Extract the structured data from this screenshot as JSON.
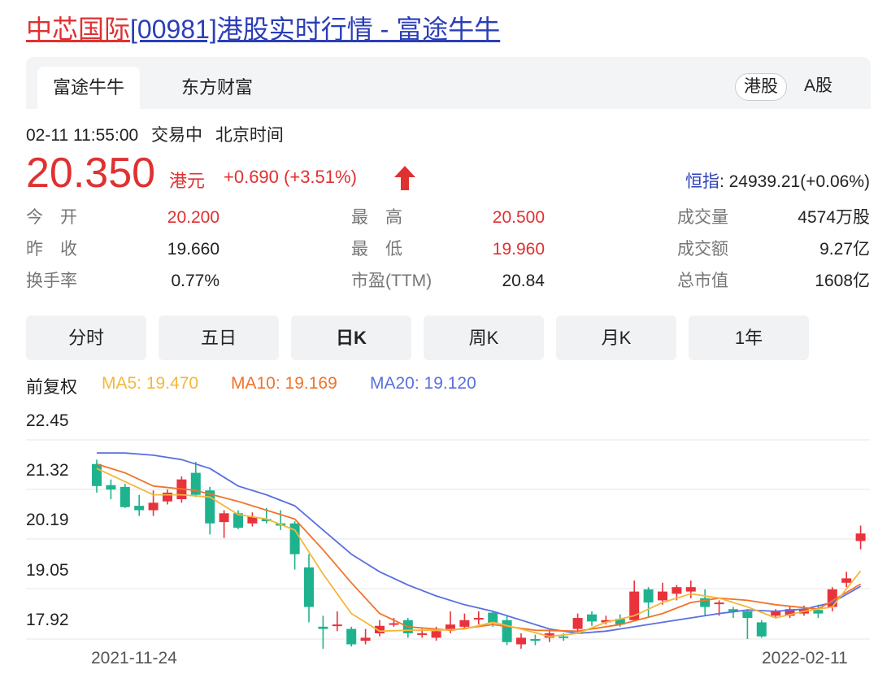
{
  "page": {
    "title_name": "中芯国际",
    "title_rest": "[00981]港股实时行情 - 富途牛牛"
  },
  "tabs": [
    "富途牛牛",
    "东方财富"
  ],
  "market": {
    "hk": "港股",
    "a": "A股"
  },
  "quote": {
    "datetime": "02-11 11:55:00",
    "status": "交易中",
    "tz": "北京时间",
    "price": "20.350",
    "currency": "港元",
    "change": "+0.690 (+3.51%)",
    "hsi_label": "恒指",
    "hsi_value": ": 24939.21(+0.06%)"
  },
  "stats": [
    [
      {
        "k": "今　开",
        "v": "20.200",
        "red": true
      },
      {
        "k": "最　高",
        "v": "20.500",
        "red": true
      },
      {
        "k": "成交量",
        "v": "4574万股",
        "red": false
      }
    ],
    [
      {
        "k": "昨　收",
        "v": "19.660",
        "red": false
      },
      {
        "k": "最　低",
        "v": "19.960",
        "red": true
      },
      {
        "k": "成交额",
        "v": "9.27亿",
        "red": false
      }
    ],
    [
      {
        "k": "换手率",
        "v": "0.77%",
        "red": false
      },
      {
        "k": "市盈(TTM)",
        "v": "20.84",
        "red": false
      },
      {
        "k": "总市值",
        "v": "1608亿",
        "red": false
      }
    ]
  ],
  "periods": [
    "分时",
    "五日",
    "日K",
    "周K",
    "月K",
    "1年"
  ],
  "active_period": "日K",
  "ma": {
    "adj": "前复权",
    "ma5": "MA5: 19.470",
    "ma10": "MA10: 19.169",
    "ma20": "MA20: 19.120"
  },
  "colors": {
    "up": "#e8323c",
    "down": "#1fb28e",
    "ma5": "#f4b73a",
    "ma10": "#f0742a",
    "ma20": "#5b6fe0",
    "accent_red": "#e03131",
    "link_blue": "#2b3eb8"
  },
  "chart_data": {
    "type": "candlestick",
    "y_ticks": [
      "22.45",
      "21.32",
      "20.19",
      "19.05",
      "17.92"
    ],
    "ylim": [
      17.5,
      22.6
    ],
    "x_start_label": "2021-11-24",
    "x_end_label": "2022-02-11",
    "candles": [
      {
        "o": 21.9,
        "c": 21.4,
        "h": 22.0,
        "l": 21.25
      },
      {
        "o": 21.42,
        "c": 21.32,
        "h": 21.55,
        "l": 21.1
      },
      {
        "o": 21.38,
        "c": 20.92,
        "h": 21.45,
        "l": 20.9
      },
      {
        "o": 20.95,
        "c": 20.85,
        "h": 21.2,
        "l": 20.72
      },
      {
        "o": 20.85,
        "c": 21.02,
        "h": 21.3,
        "l": 20.72
      },
      {
        "o": 21.05,
        "c": 21.25,
        "h": 21.32,
        "l": 20.98
      },
      {
        "o": 21.1,
        "c": 21.55,
        "h": 21.62,
        "l": 21.02
      },
      {
        "o": 21.7,
        "c": 21.2,
        "h": 21.95,
        "l": 21.15
      },
      {
        "o": 21.3,
        "c": 20.55,
        "h": 21.38,
        "l": 20.3
      },
      {
        "o": 20.58,
        "c": 20.78,
        "h": 20.85,
        "l": 20.22
      },
      {
        "o": 20.78,
        "c": 20.45,
        "h": 20.85,
        "l": 20.42
      },
      {
        "o": 20.55,
        "c": 20.7,
        "h": 20.8,
        "l": 20.48
      },
      {
        "o": 20.65,
        "c": 20.6,
        "h": 20.9,
        "l": 20.55
      },
      {
        "o": 20.55,
        "c": 20.5,
        "h": 20.85,
        "l": 20.4
      },
      {
        "o": 20.55,
        "c": 19.85,
        "h": 20.6,
        "l": 19.5
      },
      {
        "o": 19.55,
        "c": 18.65,
        "h": 19.85,
        "l": 18.3
      },
      {
        "o": 18.2,
        "c": 18.15,
        "h": 18.45,
        "l": 17.7
      },
      {
        "o": 18.25,
        "c": 18.25,
        "h": 18.55,
        "l": 18.1
      },
      {
        "o": 18.15,
        "c": 17.8,
        "h": 18.2,
        "l": 17.75
      },
      {
        "o": 17.88,
        "c": 17.95,
        "h": 18.15,
        "l": 17.8
      },
      {
        "o": 18.05,
        "c": 18.22,
        "h": 18.35,
        "l": 17.98
      },
      {
        "o": 18.25,
        "c": 18.28,
        "h": 18.4,
        "l": 18.2
      },
      {
        "o": 18.35,
        "c": 18.05,
        "h": 18.4,
        "l": 17.95
      },
      {
        "o": 18.02,
        "c": 18.05,
        "h": 18.15,
        "l": 17.95
      },
      {
        "o": 17.95,
        "c": 18.1,
        "h": 18.2,
        "l": 17.88
      },
      {
        "o": 18.12,
        "c": 18.25,
        "h": 18.55,
        "l": 18.05
      },
      {
        "o": 18.2,
        "c": 18.35,
        "h": 18.5,
        "l": 18.15
      },
      {
        "o": 18.4,
        "c": 18.4,
        "h": 18.55,
        "l": 18.25
      },
      {
        "o": 18.52,
        "c": 18.28,
        "h": 18.55,
        "l": 18.2
      },
      {
        "o": 18.35,
        "c": 17.85,
        "h": 18.45,
        "l": 17.78
      },
      {
        "o": 17.8,
        "c": 17.95,
        "h": 18.05,
        "l": 17.7
      },
      {
        "o": 17.92,
        "c": 17.88,
        "h": 18.02,
        "l": 17.78
      },
      {
        "o": 17.95,
        "c": 18.05,
        "h": 18.1,
        "l": 17.85
      },
      {
        "o": 17.98,
        "c": 17.95,
        "h": 18.05,
        "l": 17.88
      },
      {
        "o": 18.15,
        "c": 18.4,
        "h": 18.5,
        "l": 18.05
      },
      {
        "o": 18.48,
        "c": 18.32,
        "h": 18.55,
        "l": 18.22
      },
      {
        "o": 18.3,
        "c": 18.35,
        "h": 18.45,
        "l": 18.25
      },
      {
        "o": 18.38,
        "c": 18.25,
        "h": 18.48,
        "l": 18.2
      },
      {
        "o": 18.35,
        "c": 19.0,
        "h": 19.25,
        "l": 18.35
      },
      {
        "o": 19.05,
        "c": 18.75,
        "h": 19.1,
        "l": 18.4
      },
      {
        "o": 18.8,
        "c": 19.0,
        "h": 19.2,
        "l": 18.7
      },
      {
        "o": 18.95,
        "c": 19.1,
        "h": 19.15,
        "l": 18.8
      },
      {
        "o": 19.0,
        "c": 19.1,
        "h": 19.25,
        "l": 18.85
      },
      {
        "o": 18.85,
        "c": 18.65,
        "h": 19.05,
        "l": 18.45
      },
      {
        "o": 18.75,
        "c": 18.75,
        "h": 18.8,
        "l": 18.45
      },
      {
        "o": 18.6,
        "c": 18.55,
        "h": 18.65,
        "l": 18.4
      },
      {
        "o": 18.55,
        "c": 18.4,
        "h": 18.6,
        "l": 17.92
      },
      {
        "o": 18.3,
        "c": 17.98,
        "h": 18.35,
        "l": 17.95
      },
      {
        "o": 18.45,
        "c": 18.55,
        "h": 18.6,
        "l": 18.4
      },
      {
        "o": 18.45,
        "c": 18.6,
        "h": 18.65,
        "l": 18.4
      },
      {
        "o": 18.5,
        "c": 18.6,
        "h": 18.68,
        "l": 18.45
      },
      {
        "o": 18.58,
        "c": 18.5,
        "h": 18.7,
        "l": 18.4
      },
      {
        "o": 18.65,
        "c": 19.05,
        "h": 19.1,
        "l": 18.55
      },
      {
        "o": 19.2,
        "c": 19.3,
        "h": 19.45,
        "l": 19.1
      },
      {
        "o": 20.15,
        "c": 20.32,
        "h": 20.5,
        "l": 19.96
      }
    ],
    "ma5_line": [
      [
        0,
        21.8
      ],
      [
        2,
        21.5
      ],
      [
        4,
        21.2
      ],
      [
        6,
        21.2
      ],
      [
        8,
        21.15
      ],
      [
        10,
        20.75
      ],
      [
        12,
        20.65
      ],
      [
        14,
        20.4
      ],
      [
        16,
        19.4
      ],
      [
        18,
        18.5
      ],
      [
        20,
        18.1
      ],
      [
        22,
        18.12
      ],
      [
        24,
        18.12
      ],
      [
        26,
        18.15
      ],
      [
        28,
        18.3
      ],
      [
        30,
        18.15
      ],
      [
        32,
        17.98
      ],
      [
        34,
        18.05
      ],
      [
        36,
        18.3
      ],
      [
        38,
        18.45
      ],
      [
        40,
        18.75
      ],
      [
        42,
        18.95
      ],
      [
        44,
        18.85
      ],
      [
        46,
        18.65
      ],
      [
        48,
        18.4
      ],
      [
        50,
        18.55
      ],
      [
        52,
        18.65
      ],
      [
        54,
        19.47
      ]
    ],
    "ma10_line": [
      [
        0,
        21.9
      ],
      [
        2,
        21.7
      ],
      [
        4,
        21.4
      ],
      [
        7,
        21.3
      ],
      [
        10,
        21.05
      ],
      [
        12,
        20.85
      ],
      [
        14,
        20.65
      ],
      [
        16,
        19.95
      ],
      [
        18,
        19.2
      ],
      [
        20,
        18.5
      ],
      [
        22,
        18.2
      ],
      [
        25,
        18.12
      ],
      [
        28,
        18.25
      ],
      [
        31,
        18.12
      ],
      [
        34,
        18.1
      ],
      [
        37,
        18.25
      ],
      [
        40,
        18.5
      ],
      [
        42,
        18.75
      ],
      [
        44,
        18.85
      ],
      [
        46,
        18.8
      ],
      [
        48,
        18.7
      ],
      [
        51,
        18.6
      ],
      [
        54,
        19.17
      ]
    ],
    "ma20_line": [
      [
        0,
        22.15
      ],
      [
        2,
        22.15
      ],
      [
        4,
        22.1
      ],
      [
        6,
        22.0
      ],
      [
        8,
        21.8
      ],
      [
        10,
        21.4
      ],
      [
        12,
        21.2
      ],
      [
        14,
        20.95
      ],
      [
        16,
        20.4
      ],
      [
        18,
        19.85
      ],
      [
        20,
        19.45
      ],
      [
        22,
        19.15
      ],
      [
        24,
        18.9
      ],
      [
        26,
        18.7
      ],
      [
        28,
        18.55
      ],
      [
        30,
        18.35
      ],
      [
        32,
        18.15
      ],
      [
        34,
        18.05
      ],
      [
        36,
        18.1
      ],
      [
        38,
        18.2
      ],
      [
        40,
        18.3
      ],
      [
        42,
        18.4
      ],
      [
        44,
        18.5
      ],
      [
        46,
        18.58
      ],
      [
        48,
        18.55
      ],
      [
        50,
        18.6
      ],
      [
        52,
        18.75
      ],
      [
        54,
        19.12
      ]
    ]
  }
}
